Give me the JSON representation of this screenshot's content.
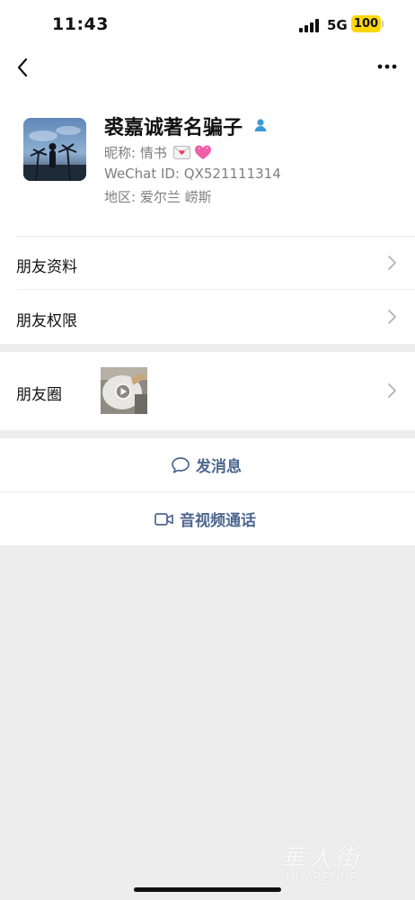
{
  "status_bar": {
    "time": "11:43",
    "network": "5G",
    "battery": "100"
  },
  "profile": {
    "name": "裘嘉诚著名骗子",
    "nickname": "昵称: 情书",
    "wechat_id": "WeChat ID: QX521111314",
    "region": "地区: 爱尔兰 崂斯"
  },
  "menu": {
    "friend_info": "朋友资料",
    "friend_permissions": "朋友权限",
    "moments": "朋友圈"
  },
  "actions": {
    "message": "发消息",
    "video_call": "音视频通话"
  },
  "watermark": {
    "cn": "華人街",
    "en": "HUARENJIE"
  },
  "colors": {
    "link_blue": "#4e6790",
    "battery_yellow": "#ffd60a",
    "page_background": "#ededed"
  },
  "icons": {
    "back": "chevron-left-icon",
    "more": "more-dots-icon",
    "verified": "person-icon",
    "message": "chat-bubble-icon",
    "video": "video-camera-icon",
    "play": "play-icon"
  }
}
